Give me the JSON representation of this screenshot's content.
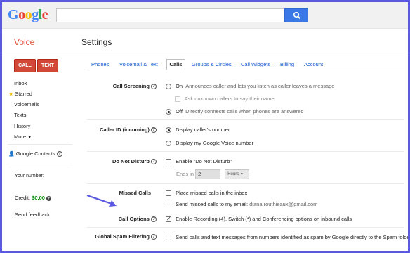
{
  "header": {
    "logo_letters": [
      {
        "ch": "G",
        "color": "#4285f4"
      },
      {
        "ch": "o",
        "color": "#ea4335"
      },
      {
        "ch": "o",
        "color": "#fbbc05"
      },
      {
        "ch": "g",
        "color": "#4285f4"
      },
      {
        "ch": "l",
        "color": "#34a853"
      },
      {
        "ch": "e",
        "color": "#ea4335"
      }
    ],
    "search_value": "",
    "search_icon": "search-icon"
  },
  "product": "Voice",
  "page_title": "Settings",
  "sidebar": {
    "call_label": "CALL",
    "text_label": "TEXT",
    "nav": [
      "Inbox",
      "Starred",
      "Voicemails",
      "Texts",
      "History",
      "More"
    ],
    "google_contacts": "Google Contacts",
    "your_number": "Your number:",
    "credit_label": "Credit:",
    "credit_value": "$0.00",
    "send_feedback": "Send feedback"
  },
  "tabs": [
    "Phones",
    "Voicemail & Text",
    "Calls",
    "Groups & Circles",
    "Call Widgets",
    "Billing",
    "Account"
  ],
  "active_tab": "Calls",
  "settings": {
    "call_screening": {
      "label": "Call Screening",
      "on_label": "On",
      "on_desc": "Announces caller and lets you listen as caller leaves a message",
      "ask_unknown": "Ask unknown callers to say their name",
      "off_label": "Off",
      "off_desc": "Directly connects calls when phones are answered"
    },
    "caller_id": {
      "label": "Caller ID (incoming)",
      "opt1": "Display caller's number",
      "opt2": "Display my Google Voice number"
    },
    "dnd": {
      "label": "Do Not Disturb",
      "enable": "Enable \"Do Not Disturb\"",
      "ends_in": "Ends in",
      "value": "2",
      "unit": "Hours"
    },
    "missed_calls": {
      "label": "Missed Calls",
      "opt1": "Place missed calls in the inbox",
      "opt2": "Send missed calls to my email:",
      "email": "diana.routhieaux@gmail.com"
    },
    "call_options": {
      "label": "Call Options",
      "opt1": "Enable Recording (4), Switch (*) and Conferencing options on inbound calls"
    },
    "spam": {
      "label": "Global Spam Filtering",
      "opt1": "Send calls and text messages from numbers identified as spam by Google directly to the Spam folder"
    }
  },
  "colors": {
    "accent_red": "#d14836",
    "link_blue": "#1155cc",
    "annotation_arrow": "#5a59e0",
    "border": "#5a59e0"
  }
}
